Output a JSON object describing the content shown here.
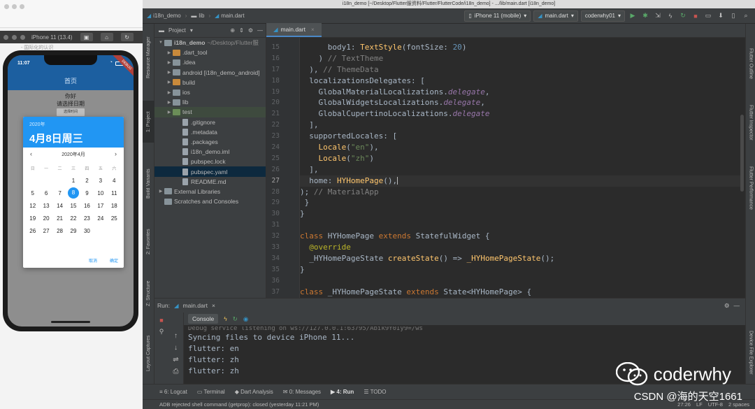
{
  "simulator": {
    "window_title": "iPhone 11 (13.4)",
    "hint": "- 国际化的认识",
    "status_time": "11:07",
    "debug_label": "DEBUG",
    "appbar_title": "首页",
    "hello_text": "你好",
    "prompt_text": "请选择日期",
    "select_button": "选择时间",
    "picker": {
      "year": "2020年",
      "header_date": "4月8日周三",
      "month_label": "2020年4月",
      "weekdays": [
        "日",
        "一",
        "二",
        "三",
        "四",
        "五",
        "六"
      ],
      "weeks": [
        [
          "",
          "",
          "",
          "1",
          "2",
          "3",
          "4"
        ],
        [
          "5",
          "6",
          "7",
          "8",
          "9",
          "10",
          "11"
        ],
        [
          "12",
          "13",
          "14",
          "15",
          "16",
          "17",
          "18"
        ],
        [
          "19",
          "20",
          "21",
          "22",
          "23",
          "24",
          "25"
        ],
        [
          "26",
          "27",
          "28",
          "29",
          "30",
          "",
          ""
        ]
      ],
      "selected_day": "8",
      "cancel_label": "取消",
      "ok_label": "确定"
    }
  },
  "ide": {
    "window_title": "i18n_demo [~/Desktop/Flutter服资料/Flutter/FlutterCode/i18n_demo] - .../lib/main.dart [i18n_demo]",
    "breadcrumb": [
      "i18n_demo",
      "lib",
      "main.dart"
    ],
    "device_combo": "iPhone 11 (mobile)",
    "run_config": "main.dart",
    "user_combo": "coderwhy01",
    "project_panel_label": "Project",
    "left_tabs": [
      "Resource Manager",
      "1: Project",
      "Build Variants",
      "2: Favorites",
      "Z: Structure",
      "Layout Captures"
    ],
    "right_tabs": [
      "Flutter Outline",
      "Flutter Inspector",
      "Flutter Performance",
      "Device File Explorer"
    ],
    "tree": [
      {
        "label": "i18n_demo",
        "path": "~/Desktop/Flutter服",
        "depth": 0,
        "arrow": "▼",
        "kind": "folder"
      },
      {
        "label": ".dart_tool",
        "path": "",
        "depth": 1,
        "arrow": "▶",
        "kind": "orange"
      },
      {
        "label": ".idea",
        "path": "",
        "depth": 1,
        "arrow": "▶",
        "kind": "folder"
      },
      {
        "label": "android [i18n_demo_android]",
        "path": "",
        "depth": 1,
        "arrow": "▶",
        "kind": "folder"
      },
      {
        "label": "build",
        "path": "",
        "depth": 1,
        "arrow": "▶",
        "kind": "orange"
      },
      {
        "label": "ios",
        "path": "",
        "depth": 1,
        "arrow": "▶",
        "kind": "folder"
      },
      {
        "label": "lib",
        "path": "",
        "depth": 1,
        "arrow": "▶",
        "kind": "folder"
      },
      {
        "label": "test",
        "path": "",
        "depth": 1,
        "arrow": "▶",
        "kind": "green"
      },
      {
        "label": ".gitignore",
        "path": "",
        "depth": 2,
        "arrow": "",
        "kind": "file"
      },
      {
        "label": ".metadata",
        "path": "",
        "depth": 2,
        "arrow": "",
        "kind": "file"
      },
      {
        "label": ".packages",
        "path": "",
        "depth": 2,
        "arrow": "",
        "kind": "file"
      },
      {
        "label": "i18n_demo.iml",
        "path": "",
        "depth": 2,
        "arrow": "",
        "kind": "file"
      },
      {
        "label": "pubspec.lock",
        "path": "",
        "depth": 2,
        "arrow": "",
        "kind": "file"
      },
      {
        "label": "pubspec.yaml",
        "path": "",
        "depth": 2,
        "arrow": "",
        "kind": "file"
      },
      {
        "label": "README.md",
        "path": "",
        "depth": 2,
        "arrow": "",
        "kind": "file"
      },
      {
        "label": "External Libraries",
        "path": "",
        "depth": 0,
        "arrow": "▶",
        "kind": "folder"
      },
      {
        "label": "Scratches and Consoles",
        "path": "",
        "depth": 0,
        "arrow": "",
        "kind": "folder"
      }
    ],
    "editor_tab": "main.dart",
    "line_numbers": [
      "15",
      "16",
      "17",
      "18",
      "19",
      "20",
      "21",
      "22",
      "23",
      "24",
      "25",
      "26",
      "27",
      "28",
      "29",
      "30",
      "31",
      "32",
      "33",
      "34",
      "35",
      "36",
      "37"
    ],
    "current_line": "27",
    "run_label": "Run:",
    "run_tab": "main.dart",
    "console_tab": "Console",
    "console_lines": [
      "Syncing files to device iPhone 11...",
      "flutter: en",
      "flutter: zh",
      "flutter: zh"
    ],
    "console_faded": "Debug service listening on ws://127.0.0.1:63795/Abik9Y0Iy9=/ws",
    "bottom_tabs": [
      "6: Logcat",
      "Terminal",
      "Dart Analysis",
      "0: Messages",
      "4: Run",
      "TODO"
    ],
    "status_message": "ADB rejected shell command (getprop): closed (yesterday 11:21 PM)",
    "status_right": [
      "27:26",
      "LF",
      "UTF-8",
      "2 spaces"
    ]
  },
  "watermark": {
    "brand": "coderwhy",
    "csdn": "CSDN @海的天空1661"
  },
  "colors": {
    "ide_bg": "#2b2b2b",
    "appbar": "#1c5fa0",
    "picker_accent": "#2196f3"
  }
}
